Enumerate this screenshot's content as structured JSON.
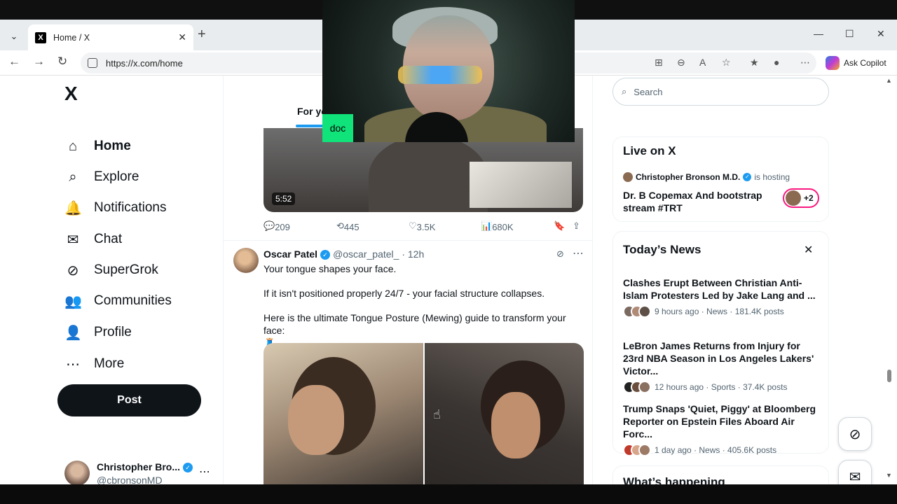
{
  "browser": {
    "tab_title": "Home / X",
    "tab_favicon": "X",
    "new_tab": "+",
    "url": "https://x.com/home",
    "copilot_label": "Ask Copilot"
  },
  "webcam": {
    "tag": "doc"
  },
  "nav": {
    "logo": "X",
    "items": [
      {
        "label": "Home",
        "icon": "home-icon",
        "glyph": "⌂"
      },
      {
        "label": "Explore",
        "icon": "search-icon",
        "glyph": "⌕"
      },
      {
        "label": "Notifications",
        "icon": "bell-icon",
        "glyph": "🔔"
      },
      {
        "label": "Chat",
        "icon": "mail-icon",
        "glyph": "✉"
      },
      {
        "label": "SuperGrok",
        "icon": "grok-icon",
        "glyph": "⊘"
      },
      {
        "label": "Communities",
        "icon": "people-icon",
        "glyph": "👥"
      },
      {
        "label": "Profile",
        "icon": "person-icon",
        "glyph": "👤"
      },
      {
        "label": "More",
        "icon": "more-circle-icon",
        "glyph": "⋯"
      }
    ],
    "post_label": "Post",
    "account": {
      "name": "Christopher Bro...",
      "handle": "@cbronsonMD"
    }
  },
  "timeline": {
    "tab_label": "For yo",
    "video": {
      "duration": "5:52"
    },
    "actions": {
      "replies": "209",
      "reposts": "445",
      "likes": "3.5K",
      "views": "680K"
    },
    "tweet": {
      "name": "Oscar Patel",
      "handle": "@oscar_patel_",
      "time": "· 12h",
      "lines": [
        "Your tongue shapes your face.",
        "If it isn't positioned properly 24/7 - your facial structure collapses.",
        "Here is the ultimate Tongue Posture (Mewing) guide to transform your face:"
      ],
      "emoji": "🧵"
    }
  },
  "sidebar": {
    "search_placeholder": "Search",
    "live": {
      "title": "Live on X",
      "host": "Christopher Bronson M.D.",
      "host_suffix": "is hosting",
      "stream_title": "Dr. B Copemax And bootstrap stream #TRT",
      "extra": "+2"
    },
    "news": {
      "title": "Today’s News",
      "items": [
        {
          "headline": "Clashes Erupt Between Christian Anti-Islam Protesters Led by Jake Lang and ...",
          "meta": "9 hours ago · News · 181.4K posts"
        },
        {
          "headline": "LeBron James Returns from Injury for 23rd NBA Season in Los Angeles Lakers' Victor...",
          "meta": "12 hours ago · Sports · 37.4K posts"
        },
        {
          "headline": "Trump Snaps 'Quiet, Piggy' at Bloomberg Reporter on Epstein Files Aboard Air Forc...",
          "meta": "1 day ago · News · 405.6K posts"
        }
      ]
    },
    "happening_title": "What’s happening"
  },
  "colors": {
    "accent": "#1d9bf0",
    "live_ring": "#f91880",
    "doc_tag": "#0fe37a"
  }
}
